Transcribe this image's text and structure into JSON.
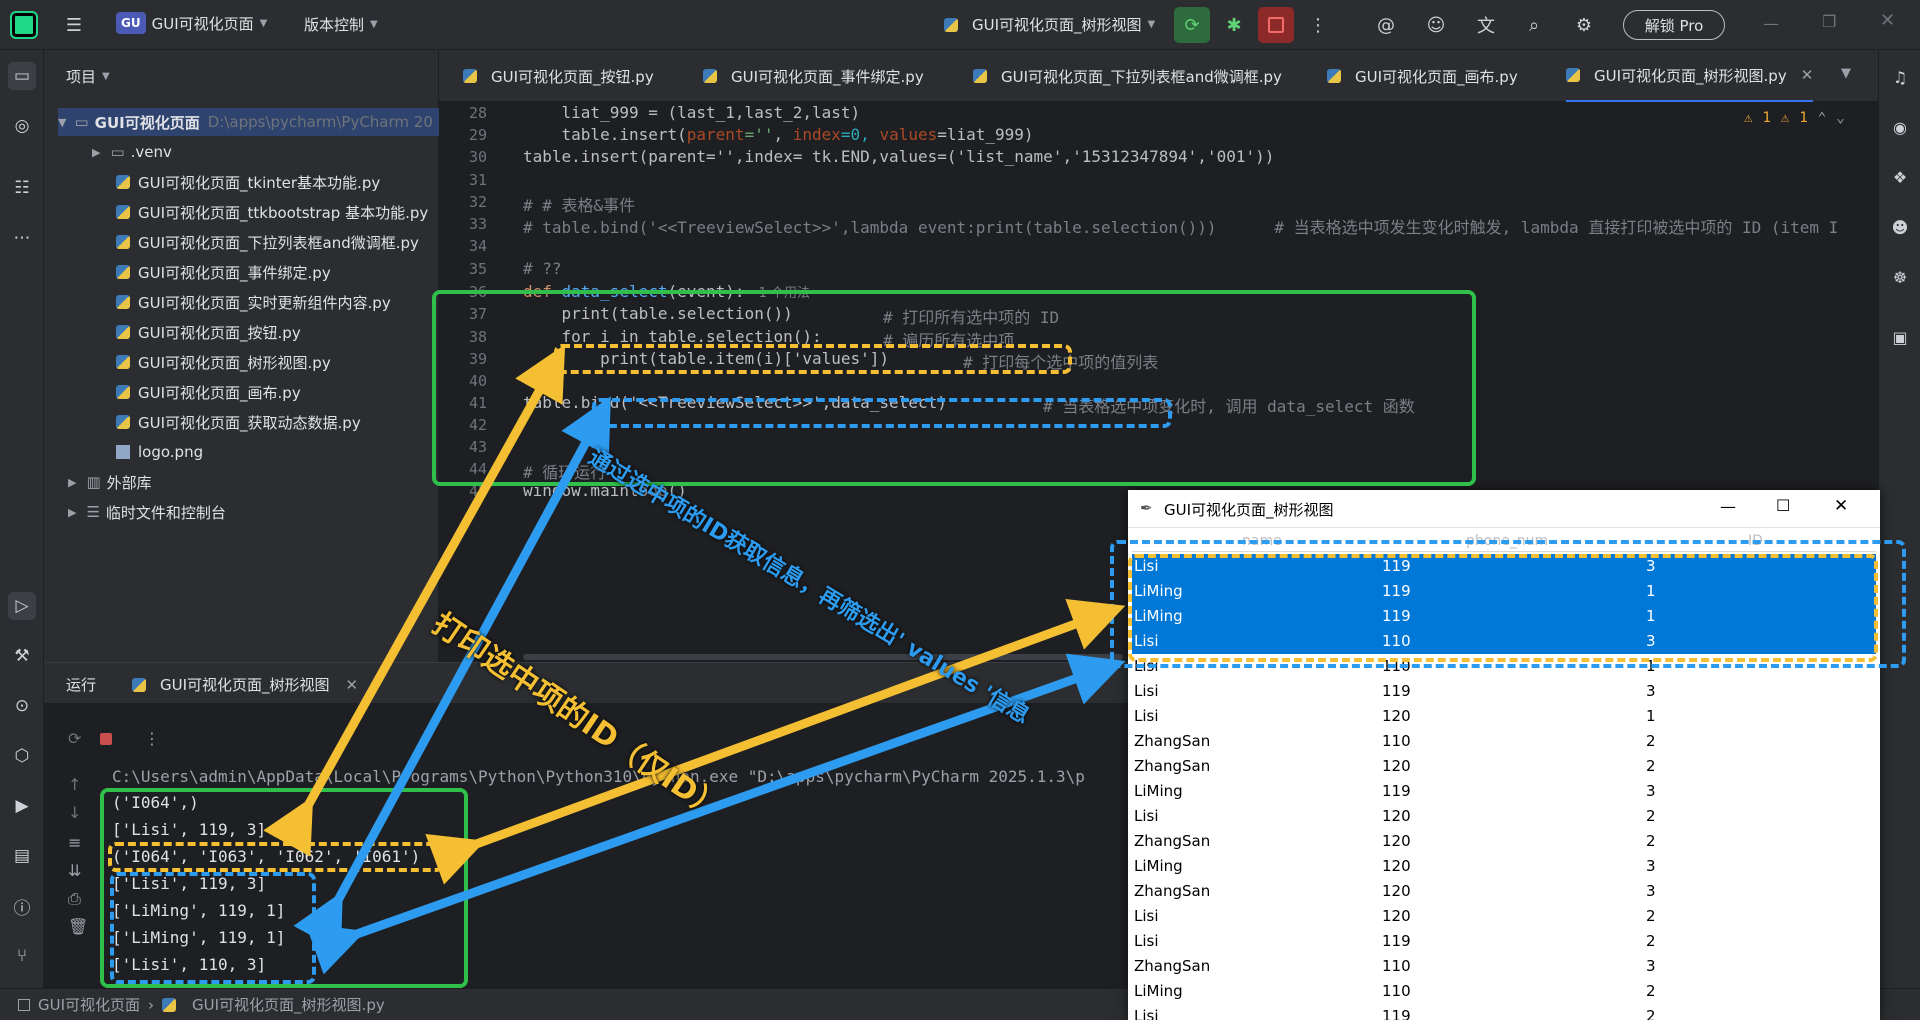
{
  "titlebar": {
    "project_badge": "GU",
    "project_name": "GUI可视化页面",
    "vcs": "版本控制",
    "run_config": "GUI可视化页面_树形视图",
    "unlock_pro": "解锁 Pro"
  },
  "project_panel": {
    "header": "项目",
    "root_name": "GUI可视化页面",
    "root_path": "D:\\apps\\pycharm\\PyCharm 20",
    "items": [
      ".venv",
      "GUI可视化页面_tkinter基本功能.py",
      "GUI可视化页面_ttkbootstrap 基本功能.py",
      "GUI可视化页面_下拉列表框and微调框.py",
      "GUI可视化页面_事件绑定.py",
      "GUI可视化页面_实时更新组件内容.py",
      "GUI可视化页面_按钮.py",
      "GUI可视化页面_树形视图.py",
      "GUI可视化页面_画布.py",
      "GUI可视化页面_获取动态数据.py",
      "logo.png"
    ],
    "external_libs": "外部库",
    "scratches": "临时文件和控制台"
  },
  "tabs": [
    "GUI可视化页面_按钮.py",
    "GUI可视化页面_事件绑定.py",
    "GUI可视化页面_下拉列表框and微调框.py",
    "GUI可视化页面_画布.py",
    "GUI可视化页面_树形视图.py"
  ],
  "editor": {
    "inspection_warnings": "1",
    "inspection_weak": "1",
    "usage_hint": "1 个用法",
    "line_numbers": [
      "28",
      "29",
      "30",
      "31",
      "32",
      "33",
      "34",
      "35",
      "36",
      "37",
      "38",
      "39",
      "40",
      "41",
      "42",
      "43",
      "44",
      "45"
    ],
    "lines": {
      "l28": "    liat_999 = (last_1,last_2,last)",
      "l29a": "    table.insert(",
      "l29b": "parent",
      "l29c": "=''",
      "l29d": ", ",
      "l29e": "index",
      "l29f": "=0, ",
      "l29g": "values",
      "l29h": "=liat_999)",
      "l30": "table.insert(parent='',index= tk.END,values=('list_name','15312347894','001'))",
      "l32": "# # 表格&事件",
      "l33": "# table.bind('<<TreeviewSelect>>',lambda event:print(table.selection()))      # 当表格选中项发生变化时触发, lambda 直接打印被选中项的 ID (item I",
      "l35": "# ??",
      "l36a": "def ",
      "l36b": "data_select",
      "l36c": "(event):",
      "l37a": "    print(table.selection())",
      "l37b": "# 打印所有选中项的 ID",
      "l38a": "    for i in table.selection():",
      "l38b": "# 遍历所有选中项",
      "l39a": "        print(table.item(i)['values'])",
      "l39b": "# 打印每个选中项的值列表",
      "l41a": "table.bind('<<TreeviewSelect>>',data_select)",
      "l41b": "# 当表格选中项变化时, 调用 data_select 函数",
      "l44": "# 循环运行",
      "l45": "window.mainloop()"
    }
  },
  "run_panel": {
    "tab_label": "运行",
    "run_name": "GUI可视化页面_树形视图",
    "output": [
      "C:\\Users\\admin\\AppData\\Local\\Programs\\Python\\Python310\\python.exe \"D:\\apps\\pycharm\\PyCharm 2025.1.3\\p",
      "('I064',)",
      "['Lisi', 119, 3]",
      "('I064', 'I063', 'I062', 'I061')",
      "['Lisi', 119, 3]",
      "['LiMing', 119, 1]",
      "['LiMing', 119, 1]",
      "['Lisi', 110, 3]"
    ]
  },
  "statusbar": {
    "crumb1": "GUI可视化页面",
    "crumb2": "GUI可视化页面_树形视图.py"
  },
  "tk_window": {
    "title": "GUI可视化页面_树形视图",
    "columns": [
      "name",
      "phone_num",
      "ID"
    ],
    "rows": [
      {
        "name": "Lisi",
        "phone": "119",
        "id": "3",
        "selected": true
      },
      {
        "name": "LiMing",
        "phone": "119",
        "id": "1",
        "selected": true
      },
      {
        "name": "LiMing",
        "phone": "119",
        "id": "1",
        "selected": true
      },
      {
        "name": "Lisi",
        "phone": "110",
        "id": "3",
        "selected": true
      },
      {
        "name": "Lisi",
        "phone": "110",
        "id": "1",
        "selected": false
      },
      {
        "name": "Lisi",
        "phone": "119",
        "id": "3",
        "selected": false
      },
      {
        "name": "Lisi",
        "phone": "120",
        "id": "1",
        "selected": false
      },
      {
        "name": "ZhangSan",
        "phone": "110",
        "id": "2",
        "selected": false
      },
      {
        "name": "ZhangSan",
        "phone": "120",
        "id": "2",
        "selected": false
      },
      {
        "name": "LiMing",
        "phone": "119",
        "id": "3",
        "selected": false
      },
      {
        "name": "Lisi",
        "phone": "120",
        "id": "2",
        "selected": false
      },
      {
        "name": "ZhangSan",
        "phone": "120",
        "id": "2",
        "selected": false
      },
      {
        "name": "LiMing",
        "phone": "120",
        "id": "3",
        "selected": false
      },
      {
        "name": "ZhangSan",
        "phone": "120",
        "id": "3",
        "selected": false
      },
      {
        "name": "Lisi",
        "phone": "120",
        "id": "2",
        "selected": false
      },
      {
        "name": "Lisi",
        "phone": "119",
        "id": "2",
        "selected": false
      },
      {
        "name": "ZhangSan",
        "phone": "110",
        "id": "3",
        "selected": false
      },
      {
        "name": "LiMing",
        "phone": "110",
        "id": "2",
        "selected": false
      },
      {
        "name": "Lisi",
        "phone": "119",
        "id": "2",
        "selected": false
      }
    ]
  },
  "annotations": {
    "yellow_label": "打印选中项的ID（仅ID）",
    "blue_label": "通过选中项的ID获取信息，再筛选出' values '信息"
  },
  "colors": {
    "accent": "#3574f0",
    "annotation_green": "#2fbf4a",
    "annotation_yellow": "#f4bf32",
    "annotation_blue": "#2d9cf0",
    "selection": "#0078d7"
  }
}
